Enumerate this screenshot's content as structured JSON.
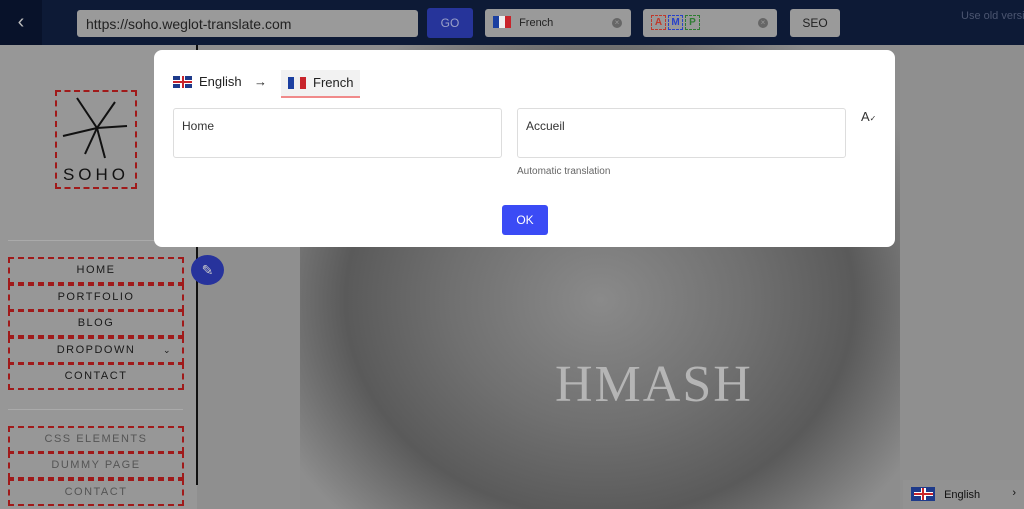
{
  "topbar": {
    "url": "https://soho.weglot-translate.com",
    "go_label": "GO",
    "language": "French",
    "amp_letters": [
      "A",
      "M",
      "P"
    ],
    "amp_colors": [
      "#c0392b",
      "#2741c9",
      "#2e7d32"
    ],
    "seo_label": "SEO",
    "old_version": "Use old version"
  },
  "site": {
    "logo_text": "SOHO",
    "hero_text": "HMASH",
    "nav": [
      "HOME",
      "PORTFOLIO",
      "BLOG",
      "DROPDOWN",
      "CONTACT"
    ],
    "nav2": [
      "CSS ELEMENTS",
      "DUMMY PAGE",
      "CONTACT"
    ],
    "language_switcher": "English"
  },
  "modal": {
    "source_lang": "English",
    "arrow": "→",
    "target_lang": "French",
    "source_text": "Home",
    "target_text": "Accueil",
    "translation_note": "Automatic translation",
    "ok_label": "OK"
  },
  "colors": {
    "accent": "#3b4bf5",
    "topbar": "#0d1a36",
    "dashed_border": "#a01a1a"
  }
}
